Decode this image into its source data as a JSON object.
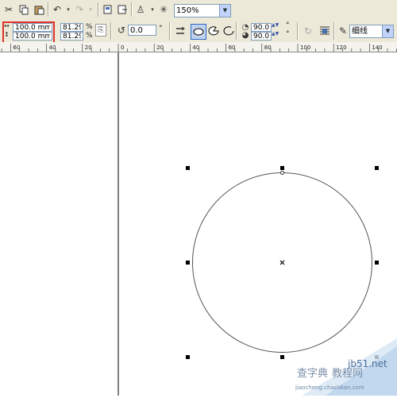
{
  "toolbar": {
    "zoom_value": "150%"
  },
  "property_bar": {
    "width_value": "100.0 mm",
    "height_value": "100.0 mm",
    "scale_x": "81.29",
    "scale_y": "81.29",
    "scale_unit": "%",
    "rotation_value": "0.0",
    "degree_symbol": "°",
    "start_angle": "90.0",
    "end_angle": "90.0",
    "outline_width": "细线"
  },
  "ruler": {
    "ticks": [
      "60",
      "40",
      "20",
      "0",
      "20",
      "40",
      "60",
      "80",
      "100",
      "120",
      "140"
    ]
  },
  "watermark": {
    "text_top": "查字典",
    "text_mid": "教程网",
    "domain": "jb51.net",
    "domain_small": "jiaocheng.chazidian.com"
  }
}
